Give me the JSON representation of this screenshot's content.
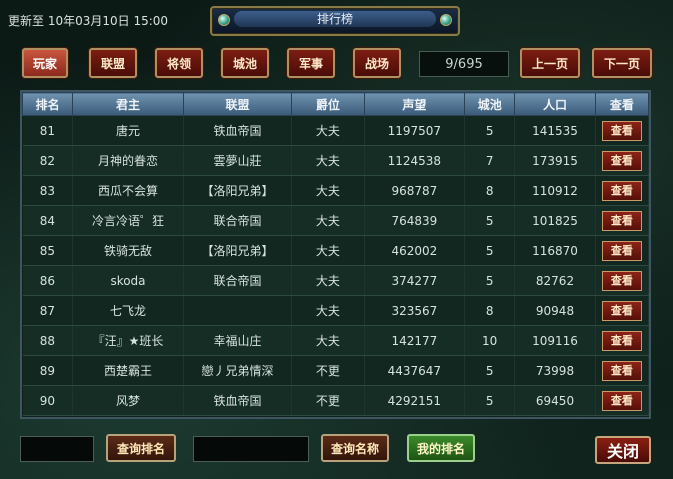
{
  "header": {
    "update_label": "更新至 10年03月10日 15:00",
    "title": "排行榜"
  },
  "tabs": [
    {
      "label": "玩家",
      "active": true
    },
    {
      "label": "联盟",
      "active": false
    },
    {
      "label": "将领",
      "active": false
    },
    {
      "label": "城池",
      "active": false
    },
    {
      "label": "军事",
      "active": false
    },
    {
      "label": "战场",
      "active": false
    }
  ],
  "pager": {
    "page_display": "9/695",
    "prev_label": "上一页",
    "next_label": "下一页"
  },
  "table": {
    "columns": [
      "排名",
      "君主",
      "联盟",
      "爵位",
      "声望",
      "城池",
      "人口",
      "查看"
    ],
    "view_label": "查看",
    "rows": [
      [
        "81",
        "唐元",
        "铁血帝国",
        "大夫",
        "1197507",
        "5",
        "141535"
      ],
      [
        "82",
        "月神的眷恋",
        "雲夢山莊",
        "大夫",
        "1124538",
        "7",
        "173915"
      ],
      [
        "83",
        "西瓜不会算",
        "【洛阳兄弟】",
        "大夫",
        "968787",
        "8",
        "110912"
      ],
      [
        "84",
        "冷言冷语゜狂",
        "联合帝国",
        "大夫",
        "764839",
        "5",
        "101825"
      ],
      [
        "85",
        "铁骑无敌",
        "【洛阳兄弟】",
        "大夫",
        "462002",
        "5",
        "116870"
      ],
      [
        "86",
        "skoda",
        "联合帝国",
        "大夫",
        "374277",
        "5",
        "82762"
      ],
      [
        "87",
        "七飞龙",
        "",
        "大夫",
        "323567",
        "8",
        "90948"
      ],
      [
        "88",
        "『汪』★班长",
        "幸福山庄",
        "大夫",
        "142177",
        "10",
        "109116"
      ],
      [
        "89",
        "西楚霸王",
        "戀丿兄弟情深",
        "不更",
        "4437647",
        "5",
        "73998"
      ],
      [
        "90",
        "风梦",
        "铁血帝国",
        "不更",
        "4292151",
        "5",
        "69450"
      ]
    ]
  },
  "bottom": {
    "rank_input_value": "",
    "search_rank_label": "查询排名",
    "name_input_value": "",
    "search_name_label": "查询名称",
    "my_rank_label": "我的排名",
    "close_label": "关闭"
  }
}
